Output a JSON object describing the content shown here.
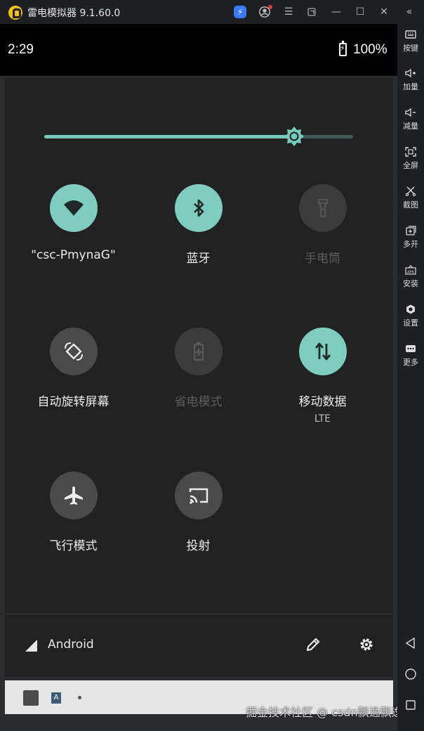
{
  "window": {
    "title": "雷电模拟器 9.1.60.0"
  },
  "status_bar": {
    "time": "2:29",
    "battery": "100%"
  },
  "quick_settings": {
    "brightness_level": 0.81,
    "tiles": [
      {
        "id": "wifi",
        "label": "\"csc-PmynaG\"",
        "state": "on",
        "icon": "wifi-icon"
      },
      {
        "id": "bluetooth",
        "label": "蓝牙",
        "state": "on",
        "icon": "bluetooth-icon"
      },
      {
        "id": "flashlight",
        "label": "手电筒",
        "state": "disabled",
        "icon": "flashlight-icon"
      },
      {
        "id": "auto_rotate",
        "label": "自动旋转屏幕",
        "state": "off",
        "icon": "rotate-icon"
      },
      {
        "id": "battery_saver",
        "label": "省电模式",
        "state": "disabled",
        "icon": "battery-saver-icon"
      },
      {
        "id": "mobile_data",
        "label": "移动数据",
        "sublabel": "LTE",
        "state": "on",
        "icon": "mobile-data-icon"
      },
      {
        "id": "airplane",
        "label": "飞行模式",
        "state": "off",
        "icon": "airplane-icon"
      },
      {
        "id": "cast",
        "label": "投射",
        "state": "off",
        "icon": "cast-icon"
      }
    ],
    "footer": {
      "carrier": "Android"
    }
  },
  "sidebar": {
    "items": [
      {
        "label": "按键",
        "icon": "keyboard-icon"
      },
      {
        "label": "加量",
        "icon": "volume-up-icon"
      },
      {
        "label": "减量",
        "icon": "volume-down-icon"
      },
      {
        "label": "全屏",
        "icon": "fullscreen-icon"
      },
      {
        "label": "截图",
        "icon": "scissors-icon"
      },
      {
        "label": "多开",
        "icon": "multi-instance-icon"
      },
      {
        "label": "安装",
        "icon": "apk-icon"
      },
      {
        "label": "设置",
        "icon": "gear-icon"
      },
      {
        "label": "更多",
        "icon": "more-icon"
      }
    ]
  },
  "watermark": "掘金技术社区 @ csdn飘逸飘逸"
}
